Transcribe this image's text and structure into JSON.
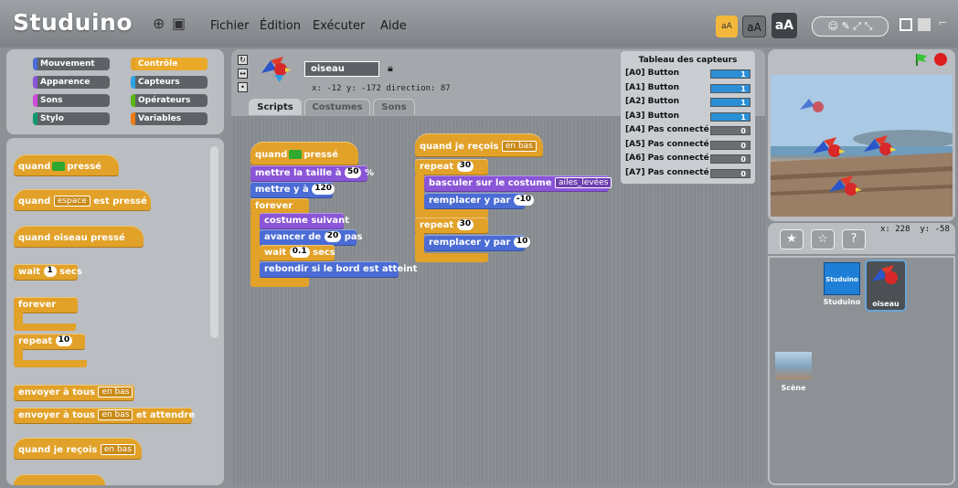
{
  "app": {
    "title": "Studuino"
  },
  "menu": {
    "items": [
      "Fichier",
      "Édition",
      "Exécuter",
      "Aide"
    ]
  },
  "font_buttons": [
    "aA",
    "aA",
    "aA"
  ],
  "categories": [
    {
      "label": "Mouvement",
      "color": "#4a6cd4",
      "selected": false
    },
    {
      "label": "Contrôle",
      "color": "#e2a128",
      "selected": true
    },
    {
      "label": "Apparence",
      "color": "#8a55d7",
      "selected": false
    },
    {
      "label": "Capteurs",
      "color": "#2ca5e2",
      "selected": false
    },
    {
      "label": "Sons",
      "color": "#cf4ad9",
      "selected": false
    },
    {
      "label": "Opérateurs",
      "color": "#5cb712",
      "selected": false
    },
    {
      "label": "Stylo",
      "color": "#0e9a6c",
      "selected": false
    },
    {
      "label": "Variables",
      "color": "#ee7d16",
      "selected": false
    }
  ],
  "palette": {
    "when_flag": "quand",
    "when_flag_suffix": "pressé",
    "when_key": "quand",
    "when_key_option": "espace",
    "when_key_suffix": "est pressé",
    "when_sprite_clicked": "quand oiseau pressé",
    "wait": "wait",
    "wait_value": "1",
    "wait_suffix": "secs",
    "forever": "forever",
    "repeat": "repeat",
    "repeat_value": "10",
    "broadcast": "envoyer à tous",
    "broadcast_option": "en bas",
    "broadcast_wait": "envoyer à tous",
    "broadcast_wait_option": "en bas",
    "broadcast_wait_suffix": "et attendre",
    "when_receive": "quand je reçois",
    "when_receive_option": "en bas"
  },
  "sprite": {
    "name": "oiseau",
    "coords": "x: -12  y: -172 direction: 87"
  },
  "tabs": [
    "Scripts",
    "Costumes",
    "Sons"
  ],
  "script1": {
    "hat": "quand",
    "hat_suffix": "pressé",
    "set_size": "mettre la taille à",
    "set_size_value": "50",
    "set_size_unit": "%",
    "set_y": "mettre y à",
    "set_y_value": "120",
    "forever": "forever",
    "next_costume": "costume suivant",
    "move": "avancer de",
    "move_value": "20",
    "move_suffix": "pas",
    "wait": "wait",
    "wait_value": "0.1",
    "wait_suffix": "secs",
    "bounce": "rebondir si le bord est atteint"
  },
  "script2": {
    "hat": "quand je reçois",
    "hat_option": "en bas",
    "repeat1": "repeat",
    "repeat1_value": "30",
    "switch_costume": "basculer sur le costume",
    "switch_costume_option": "ailes_levées",
    "change_y1": "remplacer y par",
    "change_y1_value": "-10",
    "repeat2": "repeat",
    "repeat2_value": "30",
    "change_y2": "remplacer y par",
    "change_y2_value": "10"
  },
  "sensor_table": {
    "title": "Tableau des capteurs",
    "rows": [
      {
        "label": "[A0] Button",
        "value": "1",
        "active": true
      },
      {
        "label": "[A1] Button",
        "value": "1",
        "active": true
      },
      {
        "label": "[A2] Button",
        "value": "1",
        "active": true
      },
      {
        "label": "[A3] Button",
        "value": "1",
        "active": true
      },
      {
        "label": "[A4] Pas connecté",
        "value": "0",
        "active": false
      },
      {
        "label": "[A5] Pas connecté",
        "value": "0",
        "active": false
      },
      {
        "label": "[A6] Pas connecté",
        "value": "0",
        "active": false
      },
      {
        "label": "[A7] Pas connecté",
        "value": "0",
        "active": false
      }
    ]
  },
  "stage": {
    "mouse_x": "x: 228",
    "mouse_y": "y: -58"
  },
  "sprites_list": [
    {
      "label": "Studuino",
      "thumb_text": "Studuino"
    },
    {
      "label": "oiseau",
      "selected": true
    }
  ],
  "scene": {
    "label": "Scène"
  },
  "colors": {
    "control": "#e2a128",
    "motion": "#4a6cd4",
    "looks": "#8a55d7",
    "sensor_on": "#2b8fd6",
    "sensor_off": "#6a6e72"
  }
}
